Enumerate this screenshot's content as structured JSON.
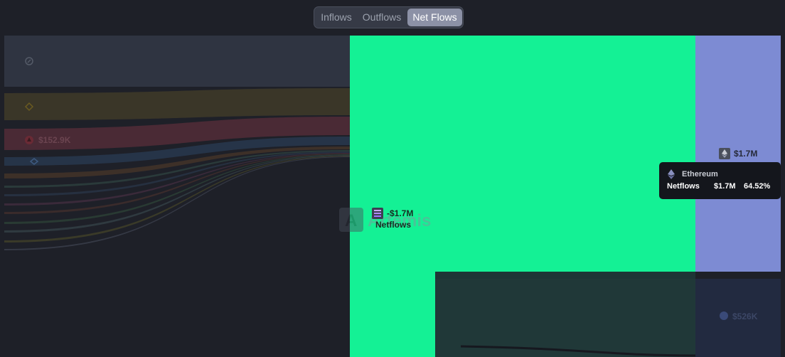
{
  "tabs": [
    {
      "label": "Inflows",
      "active": false
    },
    {
      "label": "Outflows",
      "active": false
    },
    {
      "label": "Net Flows",
      "active": true
    }
  ],
  "watermark": "Artemis",
  "chart_data": {
    "type": "sankey",
    "center_node": {
      "label": "Netflows",
      "value": "-$1.7M",
      "icon": "solana-icon",
      "color": "#14f195"
    },
    "left_nodes": [
      {
        "icon": "compass-icon",
        "value_label": "",
        "color": "#2f3441"
      },
      {
        "icon": "diamond-icon",
        "value_label": "",
        "color": "#3a3628"
      },
      {
        "icon": "avalanche-icon",
        "value_label": "$152.9K",
        "color": "#4a2a35"
      },
      {
        "icon": "chain-icon",
        "value_label": "",
        "color": "#263448"
      },
      {
        "icon": "",
        "value_label": "",
        "color": "#3d3028"
      },
      {
        "icon": "",
        "value_label": "",
        "color": "#2a3a3a"
      },
      {
        "icon": "",
        "value_label": "",
        "color": "#263040"
      },
      {
        "icon": "",
        "value_label": "",
        "color": "#3a2a3a"
      },
      {
        "icon": "",
        "value_label": "",
        "color": "#3a2b2b"
      },
      {
        "icon": "",
        "value_label": "",
        "color": "#293a33"
      },
      {
        "icon": "",
        "value_label": "",
        "color": "#2f3a40"
      },
      {
        "icon": "",
        "value_label": "",
        "color": "#3a3a28"
      },
      {
        "icon": "",
        "value_label": "",
        "color": "#353945"
      }
    ],
    "right_nodes": [
      {
        "name": "Ethereum",
        "icon": "ethereum-icon",
        "value_label": "$1.7M",
        "color": "#7d8bd3"
      },
      {
        "name": "",
        "icon": "coin-icon",
        "value_label": "$526K",
        "color": "#222a40"
      }
    ],
    "tooltip": {
      "title": "Ethereum",
      "label": "Netflows",
      "value": "$1.7M",
      "percent": "64.52%"
    }
  }
}
